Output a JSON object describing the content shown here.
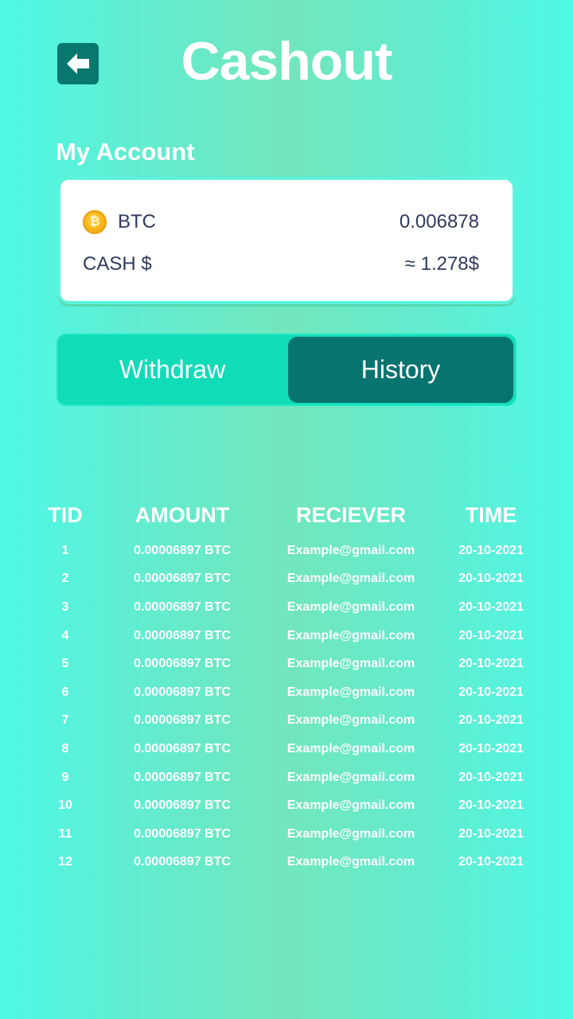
{
  "header": {
    "title": "Cashout",
    "back_icon": "arrow-left-icon"
  },
  "account": {
    "label": "My Account",
    "btc": {
      "icon": "bitcoin-coin-icon",
      "name": "BTC",
      "value": "0.006878"
    },
    "cash": {
      "name": "CASH $",
      "value": "≈ 1.278$"
    }
  },
  "tabs": {
    "withdraw": "Withdraw",
    "history": "History",
    "active": "History"
  },
  "history": {
    "columns": [
      "TID",
      "AMOUNT",
      "RECIEVER",
      "TIME"
    ],
    "rows": [
      [
        "1",
        "0.00006897 BTC",
        "Example@gmail.com",
        "20-10-2021"
      ],
      [
        "2",
        "0.00006897 BTC",
        "Example@gmail.com",
        "20-10-2021"
      ],
      [
        "3",
        "0.00006897 BTC",
        "Example@gmail.com",
        "20-10-2021"
      ],
      [
        "4",
        "0.00006897 BTC",
        "Example@gmail.com",
        "20-10-2021"
      ],
      [
        "5",
        "0.00006897 BTC",
        "Example@gmail.com",
        "20-10-2021"
      ],
      [
        "6",
        "0.00006897 BTC",
        "Example@gmail.com",
        "20-10-2021"
      ],
      [
        "7",
        "0.00006897 BTC",
        "Example@gmail.com",
        "20-10-2021"
      ],
      [
        "8",
        "0.00006897 BTC",
        "Example@gmail.com",
        "20-10-2021"
      ],
      [
        "9",
        "0.00006897 BTC",
        "Example@gmail.com",
        "20-10-2021"
      ],
      [
        "10",
        "0.00006897 BTC",
        "Example@gmail.com",
        "20-10-2021"
      ],
      [
        "11",
        "0.00006897 BTC",
        "Example@gmail.com",
        "20-10-2021"
      ],
      [
        "12",
        "0.00006897 BTC",
        "Example@gmail.com",
        "20-10-2021"
      ]
    ]
  },
  "colors": {
    "accent_dark": "#087470",
    "accent": "#10dcb8",
    "text_dark": "#2f3a5c"
  }
}
